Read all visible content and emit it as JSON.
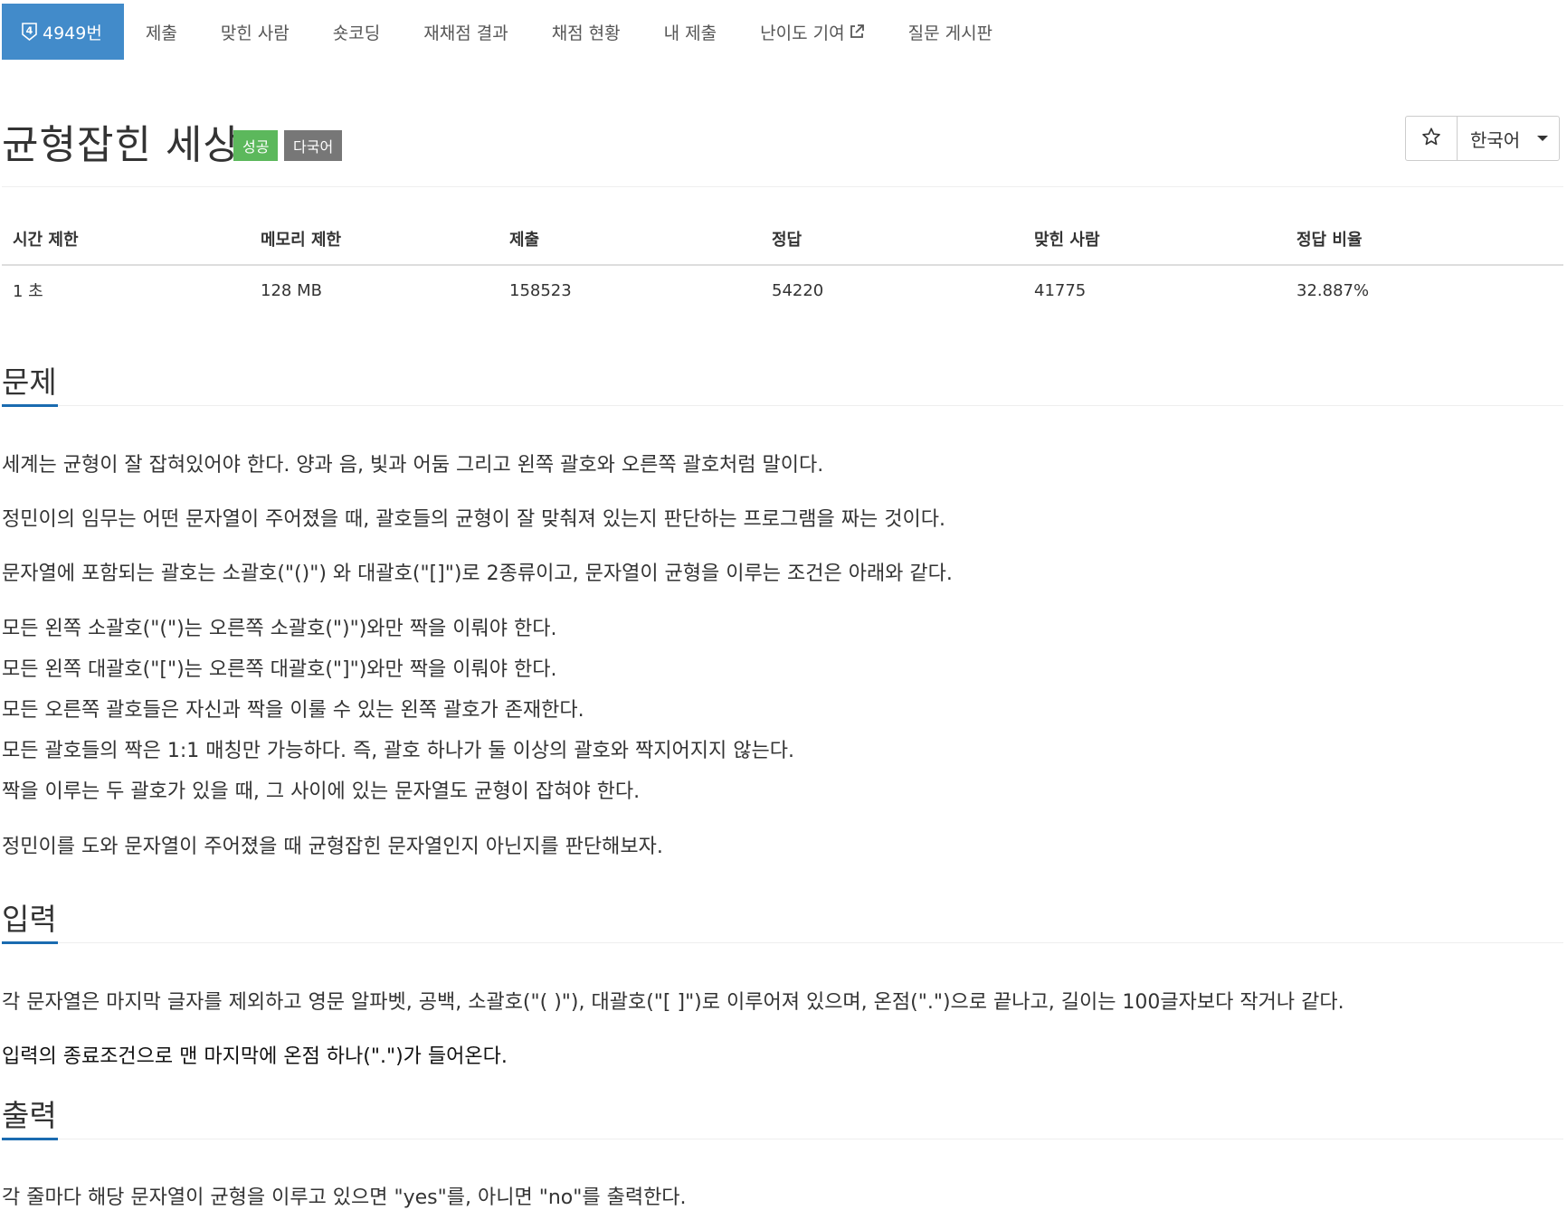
{
  "nav": {
    "problem_number": "4949번",
    "problem_icon_digit": "4",
    "items": [
      {
        "label": "제출"
      },
      {
        "label": "맞힌 사람"
      },
      {
        "label": "숏코딩"
      },
      {
        "label": "재채점 결과"
      },
      {
        "label": "채점 현황"
      },
      {
        "label": "내 제출"
      },
      {
        "label": "난이도 기여"
      },
      {
        "label": "질문 게시판"
      }
    ],
    "active_color": "#428bca"
  },
  "title": {
    "text": "균형잡힌 세상",
    "badge_success": "성공",
    "badge_multilang": "다국어",
    "badge_success_color": "#5cb85c",
    "badge_multilang_color": "#777777"
  },
  "language_select": {
    "selected": "한국어",
    "star_icon": "star-outline-icon"
  },
  "info_table": {
    "headers": [
      "시간 제한",
      "메모리 제한",
      "제출",
      "정답",
      "맞힌 사람",
      "정답 비율"
    ],
    "values": [
      "1 초",
      "128 MB",
      "158523",
      "54220",
      "41775",
      "32.887%"
    ]
  },
  "sections": {
    "problem": {
      "heading": "문제",
      "paragraphs": [
        "세계는 균형이 잘 잡혀있어야 한다. 양과 음, 빛과 어둠 그리고 왼쪽 괄호와 오른쪽 괄호처럼 말이다.",
        "정민이의 임무는 어떤 문자열이 주어졌을 때, 괄호들의 균형이 잘 맞춰져 있는지 판단하는 프로그램을 짜는 것이다.",
        "문자열에 포함되는 괄호는 소괄호(\"()\") 와 대괄호(\"[]\")로 2종류이고, 문자열이 균형을 이루는 조건은 아래와 같다."
      ],
      "conditions": [
        "모든 왼쪽 소괄호(\"(\")는 오른쪽 소괄호(\")\")와만 짝을 이뤄야 한다.",
        "모든 왼쪽 대괄호(\"[\")는 오른쪽 대괄호(\"]\")와만 짝을 이뤄야 한다.",
        "모든 오른쪽 괄호들은 자신과 짝을 이룰 수 있는 왼쪽 괄호가 존재한다.",
        "모든 괄호들의 짝은 1:1 매칭만 가능하다. 즉, 괄호 하나가 둘 이상의 괄호와 짝지어지지 않는다.",
        "짝을 이루는 두 괄호가 있을 때, 그 사이에 있는 문자열도 균형이 잡혀야 한다."
      ],
      "closing": "정민이를 도와 문자열이 주어졌을 때 균형잡힌 문자열인지 아닌지를 판단해보자."
    },
    "input": {
      "heading": "입력",
      "paragraphs": [
        "각 문자열은 마지막 글자를 제외하고 영문 알파벳, 공백, 소괄호(\"( )\"), 대괄호(\"[ ]\")로 이루어져 있으며, 온점(\".\")으로 끝나고, 길이는 100글자보다 작거나 같다.",
        "입력의 종료조건으로 맨 마지막에 온점 하나(\".\")가 들어온다."
      ]
    },
    "output": {
      "heading": "출력",
      "paragraphs": [
        "각 줄마다 해당 문자열이 균형을 이루고 있으면 \"yes\"를, 아니면 \"no\"를 출력한다."
      ]
    }
  }
}
